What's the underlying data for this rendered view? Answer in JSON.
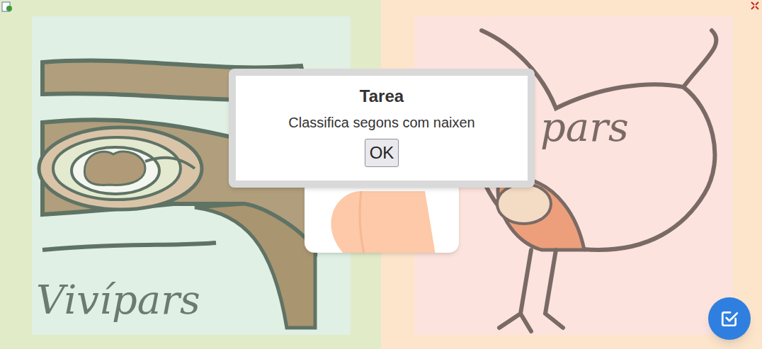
{
  "game": {
    "task_dialog": {
      "title": "Tarea",
      "message": "Classifica segons com naixen",
      "button": "OK"
    },
    "categories": [
      {
        "label": "Vivípars",
        "color": "#e0f0e4"
      },
      {
        "label": "pars",
        "color": "#fde3dd"
      }
    ]
  }
}
